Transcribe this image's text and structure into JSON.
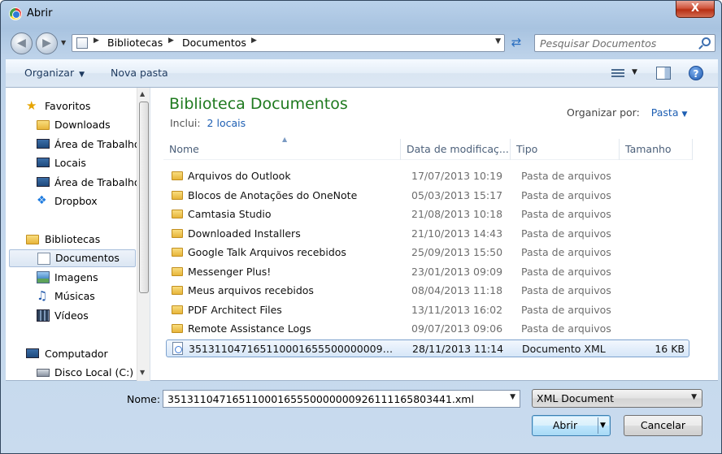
{
  "window": {
    "title": "Abrir",
    "close_label": "X"
  },
  "address": {
    "crumbs": [
      "Bibliotecas",
      "Documentos"
    ],
    "search_placeholder": "Pesquisar Documentos"
  },
  "toolbar": {
    "organize_label": "Organizar",
    "new_folder_label": "Nova pasta",
    "help_label": "?"
  },
  "sidebar": {
    "favorites_label": "Favoritos",
    "favorites": [
      "Downloads",
      "Área de Trabalho",
      "Locais",
      "Área de Trabalho",
      "Dropbox"
    ],
    "libraries_label": "Bibliotecas",
    "libraries": [
      "Documentos",
      "Imagens",
      "Músicas",
      "Vídeos"
    ],
    "computer_label": "Computador",
    "computer": [
      "Disco Local (C:)"
    ]
  },
  "main": {
    "title": "Biblioteca Documentos",
    "includes_label": "Inclui:",
    "includes_link": "2 locais",
    "arrange_label": "Organizar por:",
    "arrange_value": "Pasta",
    "columns": [
      "Nome",
      "Data de modificaç...",
      "Tipo",
      "Tamanho"
    ],
    "files": [
      {
        "name": "Arquivos do Outlook",
        "date": "17/07/2013 10:19",
        "type": "Pasta de arquivos",
        "size": ""
      },
      {
        "name": "Blocos de Anotações do OneNote",
        "date": "05/03/2013 15:17",
        "type": "Pasta de arquivos",
        "size": ""
      },
      {
        "name": "Camtasia Studio",
        "date": "21/08/2013 10:18",
        "type": "Pasta de arquivos",
        "size": ""
      },
      {
        "name": "Downloaded Installers",
        "date": "21/10/2013 14:43",
        "type": "Pasta de arquivos",
        "size": ""
      },
      {
        "name": "Google Talk Arquivos recebidos",
        "date": "25/09/2013 15:50",
        "type": "Pasta de arquivos",
        "size": ""
      },
      {
        "name": "Messenger Plus!",
        "date": "23/01/2013 09:09",
        "type": "Pasta de arquivos",
        "size": ""
      },
      {
        "name": "Meus arquivos recebidos",
        "date": "08/04/2013 11:18",
        "type": "Pasta de arquivos",
        "size": ""
      },
      {
        "name": "PDF Architect Files",
        "date": "13/11/2013 16:02",
        "type": "Pasta de arquivos",
        "size": ""
      },
      {
        "name": "Remote Assistance Logs",
        "date": "09/07/2013 09:06",
        "type": "Pasta de arquivos",
        "size": ""
      },
      {
        "name": "35131104716511000165550000000926111...",
        "date": "28/11/2013 11:14",
        "type": "Documento XML",
        "size": "16 KB"
      }
    ]
  },
  "footer": {
    "filename_label": "Nome:",
    "filename_value": "35131104716511000165550000000926111165803441.xml",
    "filetype_value": "XML Document",
    "open_label": "Abrir",
    "cancel_label": "Cancelar"
  },
  "colors": {
    "library_title": "#1f7a1f",
    "link": "#1e5fb3",
    "selection_border": "#7da2ce"
  }
}
